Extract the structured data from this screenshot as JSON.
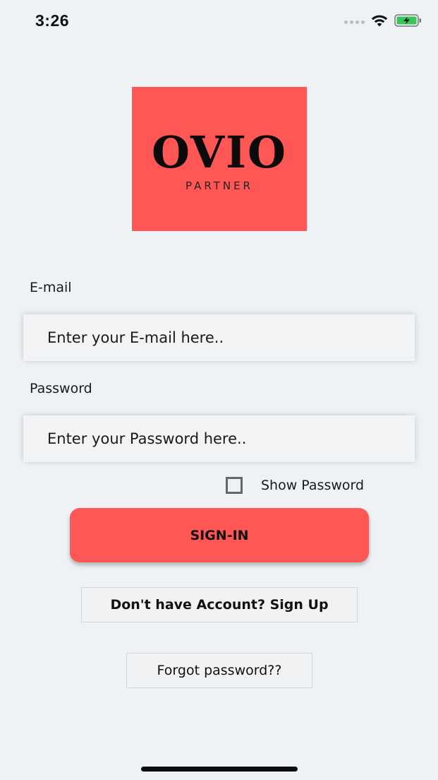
{
  "status_bar": {
    "time": "3:26",
    "icons": [
      "cellular-dots-icon",
      "wifi-icon",
      "battery-charging-icon"
    ],
    "battery_color": "#34c759"
  },
  "logo": {
    "title": "OVIO",
    "subtitle": "PARTNER",
    "background_color": "#ff5656"
  },
  "form": {
    "email_label": "E-mail",
    "email_placeholder": "Enter your E-mail here..",
    "password_label": "Password",
    "password_placeholder": "Enter your Password here..",
    "show_password_label": "Show Password",
    "show_password_checked": false
  },
  "buttons": {
    "signin": "SIGN-IN",
    "signup": "Don't have Account? Sign Up",
    "forgot": "Forgot password??"
  },
  "colors": {
    "accent": "#ff5656",
    "background": "#eff2f5"
  }
}
